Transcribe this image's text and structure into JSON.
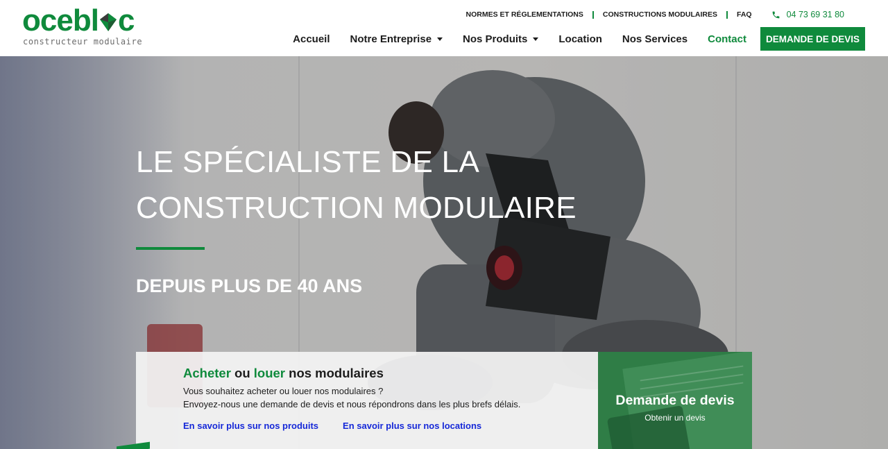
{
  "brand": {
    "name": "ocebloc",
    "name_before": "oceb",
    "name_l": "l",
    "name_after": "c",
    "tagline": "constructeur modulaire",
    "color": "#0f8a3c"
  },
  "topbar": {
    "links": [
      "NORMES ET RÉGLEMENTATIONS",
      "CONSTRUCTIONS MODULAIRES",
      "FAQ"
    ],
    "phone": "04 73 69 31 80",
    "phone_icon": "phone-icon"
  },
  "nav": {
    "items": [
      {
        "label": "Accueil",
        "dropdown": false
      },
      {
        "label": "Notre Entreprise",
        "dropdown": true
      },
      {
        "label": "Nos Produits",
        "dropdown": true
      },
      {
        "label": "Location",
        "dropdown": false
      },
      {
        "label": "Nos Services",
        "dropdown": false
      },
      {
        "label": "Contact",
        "dropdown": false,
        "active": true
      }
    ],
    "cta": "DEMANDE DE DEVIS"
  },
  "hero": {
    "title_line1": "LE SPÉCIALISTE DE LA",
    "title_line2": "CONSTRUCTION MODULAIRE",
    "subtitle": "DEPUIS PLUS DE 40 ANS"
  },
  "info": {
    "title_acheter": "Acheter",
    "title_ou": "ou",
    "title_louer": "louer",
    "title_rest": "nos modulaires",
    "text_line1": "Vous souhaitez acheter ou louer nos modulaires ?",
    "text_line2": "Envoyez-nous une demande de devis et nous répondrons dans les plus brefs délais.",
    "link_products": "En savoir plus sur nos produits",
    "link_locations": "En savoir plus sur nos locations"
  },
  "cta_box": {
    "title": "Demande de devis",
    "subtitle": "Obtenir un devis"
  },
  "colors": {
    "accent": "#0f8a3c",
    "link": "#1528d8",
    "text": "#1c1c1c"
  }
}
